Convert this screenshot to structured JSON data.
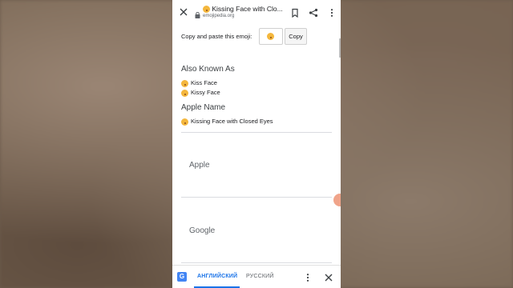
{
  "browser": {
    "title": "Kissing Face with Clo...",
    "url": "emojipedia.org"
  },
  "copy": {
    "label": "Copy and paste this emoji:",
    "button": "Copy"
  },
  "also_known_as": {
    "heading": "Also Known As",
    "items": [
      "Kiss Face",
      "Kissy Face"
    ]
  },
  "apple_name": {
    "heading": "Apple Name",
    "value": "Kissing Face with Closed Eyes"
  },
  "vendors": [
    "Apple",
    "Google"
  ],
  "translate": {
    "source_lang": "АНГЛИЙСКИЙ",
    "target_lang": "РУССКИЙ"
  },
  "icons": [
    "close-icon",
    "lock-icon",
    "bookmark-icon",
    "share-icon",
    "more-vert-icon",
    "google-translate-icon",
    "emoji-icon"
  ],
  "colors": {
    "accent": "#1a73e8",
    "emoji": "#f4b73d"
  }
}
